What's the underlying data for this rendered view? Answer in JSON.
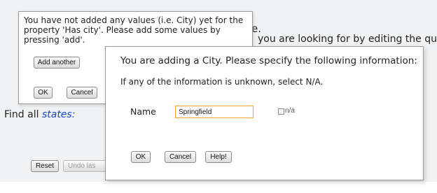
{
  "background": {
    "find_all_label": "Find all",
    "states_link": "states:",
    "fragment_e": "e.",
    "fragment_query": "you are looking for by editing the query",
    "reset_button": "Reset",
    "undo_button": "Undo las"
  },
  "small_dialog": {
    "message": "You have not added any values (i.e. City) yet for the property 'Has city'. Please add some values by pressing 'add'.",
    "add_another_button": "Add another",
    "ok_button": "OK",
    "cancel_button": "Cancel"
  },
  "main_dialog": {
    "title": "You are adding a City. Please specify the following information:",
    "subtitle": "If any of the information is unknown, select N/A.",
    "name_label": "Name",
    "name_value": "Springfield",
    "na_label": "n/a",
    "na_checked": false,
    "ok_button": "OK",
    "cancel_button": "Cancel",
    "help_button": "Help!"
  },
  "colors": {
    "link": "#1e44c8",
    "input_focus_border": "#f0a030",
    "page_background": "#f1f2f3"
  }
}
